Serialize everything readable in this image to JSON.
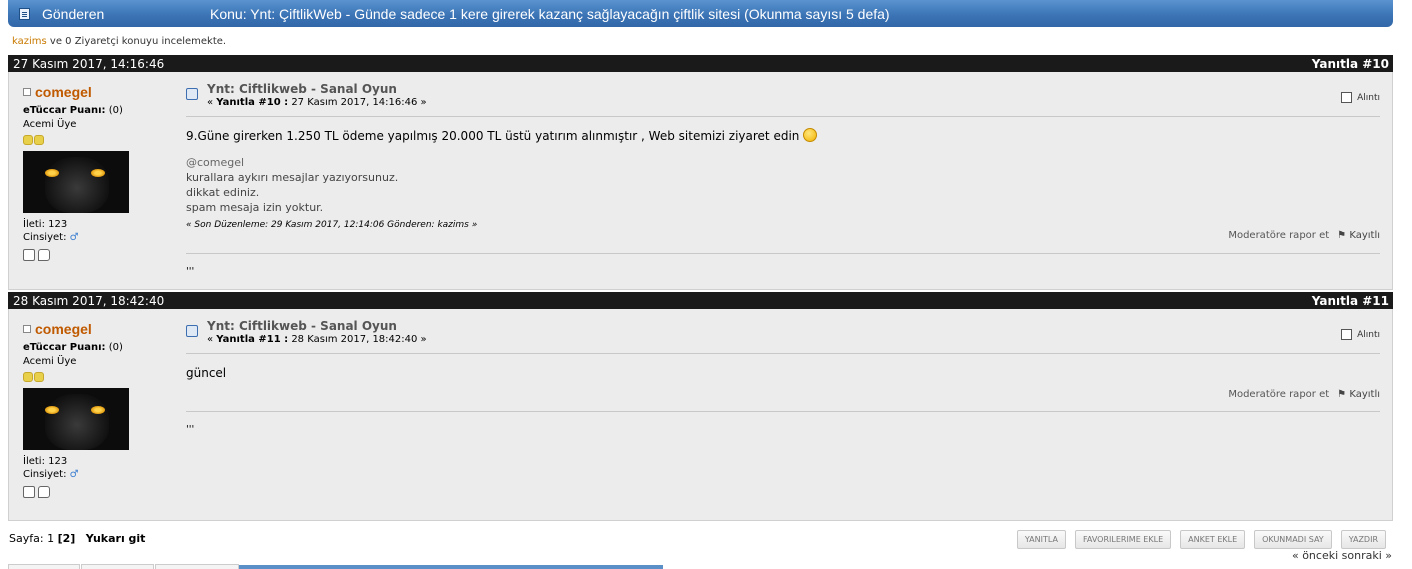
{
  "topbar": {
    "sender_label": "Gönderen",
    "subject": "Konu: Ynt: ÇiftlikWeb - Günde sadece 1 kere girerek kazanç sağlayacağın çiftlik sitesi  (Okunma sayısı 5 defa)"
  },
  "viewers": {
    "user": "kazims",
    "text": " ve 0 Ziyaretçi konuyu incelemekte."
  },
  "posts": [
    {
      "date": "27 Kasım 2017, 14:16:46",
      "reply_label": "Yanıtla #10",
      "poster": {
        "name": "comegel",
        "rating_label": "eTüccar Puanı:",
        "rating_value": "(0)",
        "rank": "Acemi Üye",
        "posts_label": "İleti: 123",
        "gender_label": "Cinsiyet:",
        "gender_symbol": "♂"
      },
      "title": "Ynt: Ciftlikweb - Sanal Oyun",
      "meta_prefix": "« ",
      "meta_bold": "Yanıtla #10 :",
      "meta_date": " 27 Kasım 2017, 14:16:46 »",
      "quote_label": "Alıntı",
      "message": "9.Güne girerken 1.250 TL ödeme  yapılmış 20.000 TL üstü yatırım alınmıştır , Web sitemizi ziyaret edin",
      "mod_mention": "@comegel",
      "mod_lines": [
        "kurallara aykırı mesajlar yazıyorsunuz.",
        "dikkat ediniz.",
        "spam mesaja izin yoktur."
      ],
      "edit_note": "« Son Düzenleme: 29 Kasım 2017, 12:14:06 Gönderen: kazims »",
      "report_label": "Moderatöre rapor et",
      "logged_label": "Kayıtlı",
      "signature": "'''"
    },
    {
      "date": "28 Kasım 2017, 18:42:40",
      "reply_label": "Yanıtla #11",
      "poster": {
        "name": "comegel",
        "rating_label": "eTüccar Puanı:",
        "rating_value": "(0)",
        "rank": "Acemi Üye",
        "posts_label": "İleti: 123",
        "gender_label": "Cinsiyet:",
        "gender_symbol": "♂"
      },
      "title": "Ynt: Ciftlikweb - Sanal Oyun",
      "meta_prefix": "« ",
      "meta_bold": "Yanıtla #11 :",
      "meta_date": " 28 Kasım 2017, 18:42:40 »",
      "quote_label": "Alıntı",
      "message": "güncel",
      "report_label": "Moderatöre rapor et",
      "logged_label": "Kayıtlı",
      "signature": "'''"
    }
  ],
  "pagination": {
    "label": "Sayfa:",
    "page1": "1",
    "current": "[2]",
    "top_link": "Yukarı git"
  },
  "buttons": [
    "YANITLA",
    "FAVORILERIME EKLE",
    "ANKET EKLE",
    "OKUNMADI SAY",
    "YAZDIR"
  ],
  "nav": {
    "prev": "« önceki",
    "next": "sonraki »"
  },
  "colors": {
    "header_blue": "#3a72b4",
    "cat_bar": "#1a1a1a",
    "post_bg": "#ececec",
    "username": "#c05a00"
  }
}
